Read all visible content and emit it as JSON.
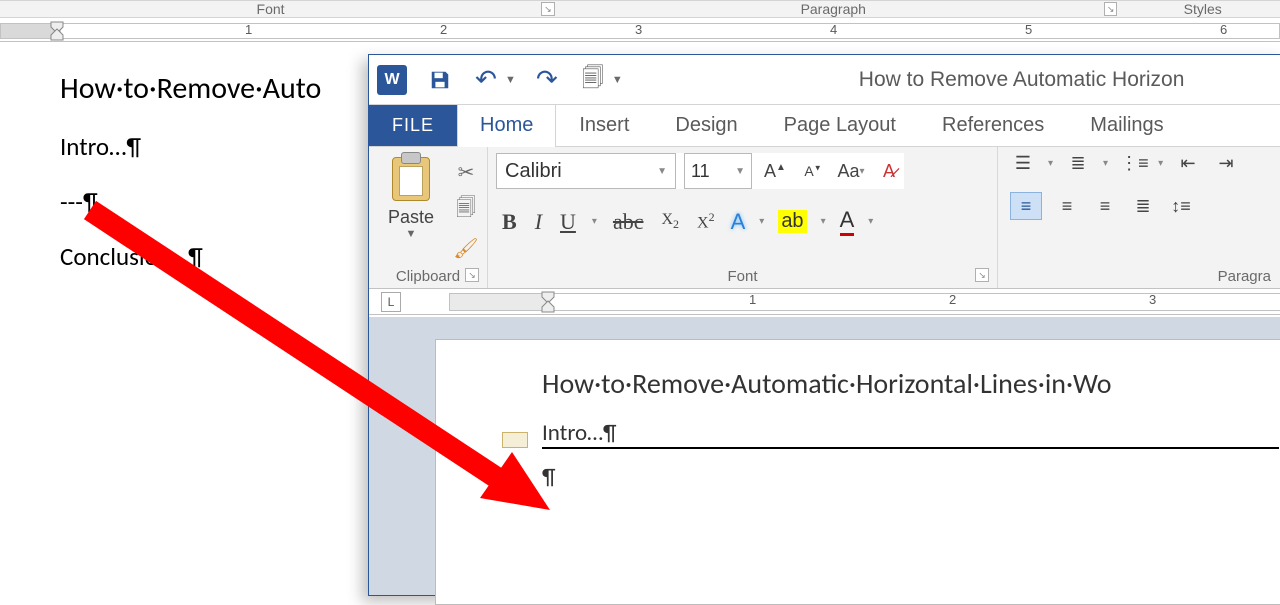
{
  "bg": {
    "group_font": "Font",
    "group_para": "Paragraph",
    "group_styles": "Styles",
    "title": "How·to·Remove·Auto",
    "intro": "Intro…¶",
    "dashes": "---¶",
    "conclusion": "Conclusion…¶",
    "ruler": [
      "1",
      "2",
      "3",
      "4",
      "5",
      "6"
    ]
  },
  "fg": {
    "window_title": "How to Remove Automatic Horizon",
    "tabs": {
      "file": "FILE",
      "home": "Home",
      "insert": "Insert",
      "design": "Design",
      "layout": "Page Layout",
      "references": "References",
      "mailings": "Mailings"
    },
    "clipboard": {
      "paste": "Paste",
      "label": "Clipboard"
    },
    "font": {
      "name": "Calibri",
      "size": "11",
      "label": "Font"
    },
    "paragraph": {
      "label": "Paragra"
    },
    "ruler": [
      "1",
      "2",
      "3"
    ],
    "doc": {
      "title": "How·to·Remove·Automatic·Horizontal·Lines·in·Wo",
      "intro": "Intro…¶",
      "blank": "¶"
    }
  }
}
